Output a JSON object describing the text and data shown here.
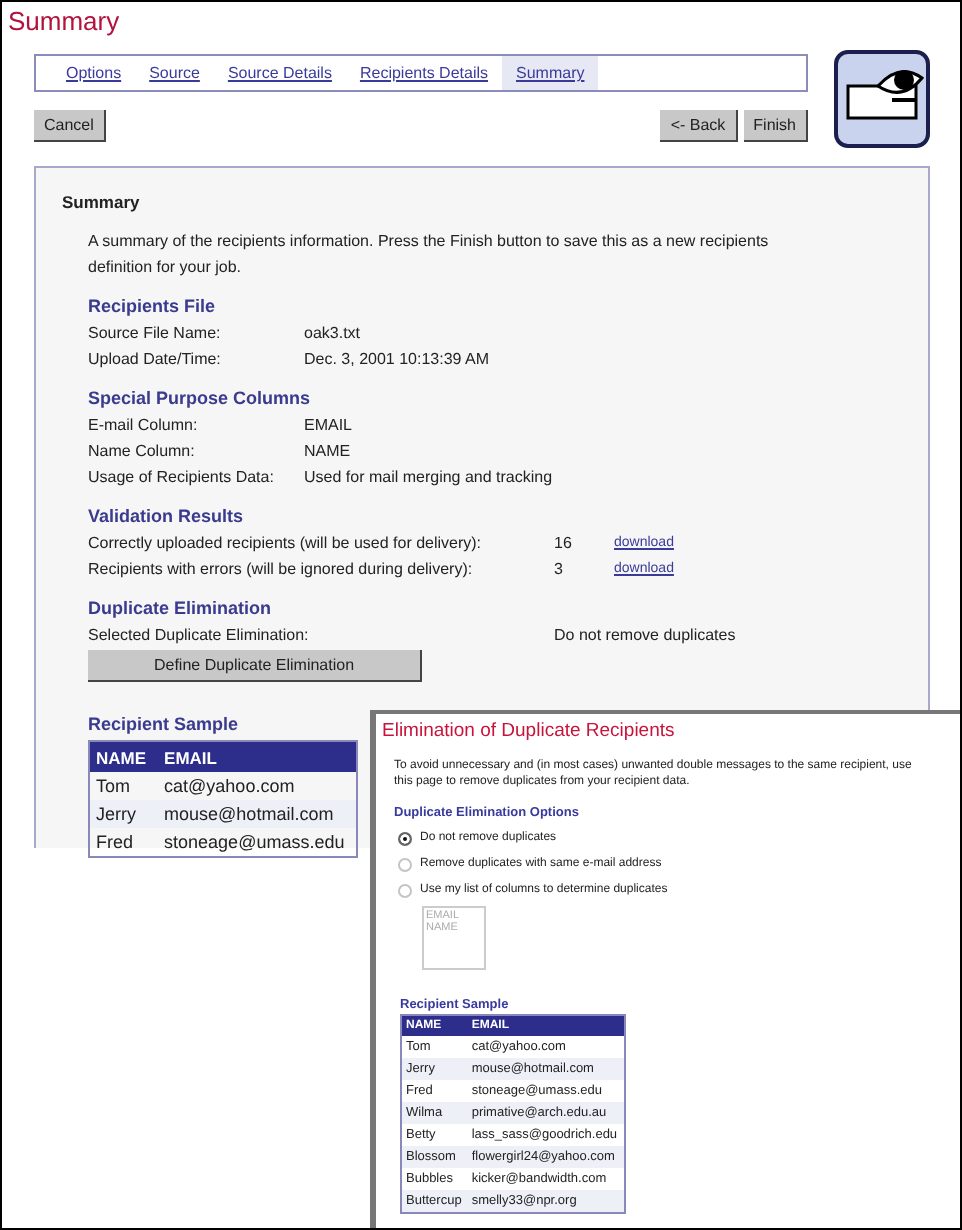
{
  "page_title": "Summary",
  "tabs": [
    {
      "label": "Options",
      "selected": false
    },
    {
      "label": "Source",
      "selected": false
    },
    {
      "label": "Source Details",
      "selected": false
    },
    {
      "label": "Recipients Details",
      "selected": false
    },
    {
      "label": "Summary",
      "selected": true
    }
  ],
  "buttons": {
    "cancel": "Cancel",
    "back": "<- Back",
    "finish": "Finish"
  },
  "panel": {
    "heading": "Summary",
    "intro": "A summary of the recipients information. Press the Finish button to save this as a new recipients definition for your job.",
    "sections": [
      {
        "kind": "pairs",
        "title": "Recipients File",
        "rows": [
          {
            "label": "Source File Name:",
            "value": "oak3.txt"
          },
          {
            "label": "Upload Date/Time:",
            "value": "Dec. 3, 2001 10:13:39 AM"
          }
        ]
      },
      {
        "kind": "pairs",
        "title": "Special Purpose Columns",
        "rows": [
          {
            "label": "E-mail Column:",
            "value": "EMAIL"
          },
          {
            "label": "Name Column:",
            "value": "NAME"
          },
          {
            "label": "Usage of Recipients Data:",
            "value": "Used for mail merging and tracking"
          }
        ]
      },
      {
        "kind": "wide",
        "title": "Validation Results",
        "rows": [
          {
            "label": "Correctly uploaded recipients (will be used for delivery):",
            "value": "16",
            "link": "download"
          },
          {
            "label": "Recipients with errors (will be ignored during delivery):",
            "value": "3",
            "link": "download"
          }
        ]
      },
      {
        "kind": "wide",
        "title": "Duplicate Elimination",
        "rows": [
          {
            "label": "Selected Duplicate Elimination:",
            "value": "Do not remove duplicates"
          }
        ],
        "button": "Define Duplicate Elimination"
      }
    ],
    "sample": {
      "title": "Recipient Sample",
      "columns": [
        "NAME",
        "EMAIL"
      ],
      "rows": [
        [
          "Tom",
          "cat@yahoo.com"
        ],
        [
          "Jerry",
          "mouse@hotmail.com"
        ],
        [
          "Fred",
          "stoneage@umass.edu"
        ]
      ]
    }
  },
  "popup": {
    "title": "Elimination of Duplicate Recipients",
    "intro": "To avoid unnecessary and (in most cases) unwanted double messages to the same recipient, use this page to remove duplicates from your recipient data.",
    "options_title": "Duplicate Elimination Options",
    "options": [
      {
        "label": "Do not remove duplicates",
        "selected": true
      },
      {
        "label": "Remove duplicates with same e-mail address",
        "selected": false
      },
      {
        "label": "Use my list of columns to determine duplicates",
        "selected": false
      }
    ],
    "column_list": {
      "items": [
        "EMAIL",
        "NAME"
      ],
      "disabled": true
    },
    "sample": {
      "title": "Recipient Sample",
      "columns": [
        "NAME",
        "EMAIL"
      ],
      "rows": [
        [
          "Tom",
          "cat@yahoo.com"
        ],
        [
          "Jerry",
          "mouse@hotmail.com"
        ],
        [
          "Fred",
          "stoneage@umass.edu"
        ],
        [
          "Wilma",
          "primative@arch.edu.au"
        ],
        [
          "Betty",
          "lass_sass@goodrich.edu"
        ],
        [
          "Blossom",
          "flowergirl24@yahoo.com"
        ],
        [
          "Bubbles",
          "kicker@bandwidth.com"
        ],
        [
          "Buttercup",
          "smelly33@npr.org"
        ]
      ]
    }
  }
}
